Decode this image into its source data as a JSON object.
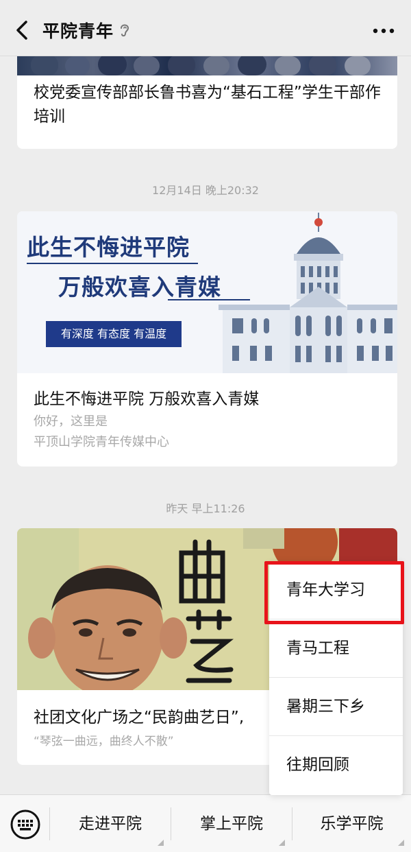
{
  "nav": {
    "title": "平院青年",
    "back_icon": "chevron-left-icon",
    "ear_icon": "ear-icon",
    "more_icon": "more-dots-icon"
  },
  "articles": [
    {
      "title": "校党委宣传部部长鲁书喜为“基石工程”学生干部作培训"
    },
    {
      "time": "12月14日 晚上20:32",
      "banner_line1": "此生不悔进平院",
      "banner_line2": "万般欢喜入青媒",
      "banner_tag": "有深度  有态度  有温度",
      "title": "此生不悔进平院 万般欢喜入青媒",
      "desc_line1": "你好，这里是",
      "desc_line2": "平顶山学院青年传媒中心"
    },
    {
      "time": "昨天 早上11:26",
      "title": "社团文化广场之“民韵曲艺日”,",
      "desc": "“琴弦一曲远，曲终人不散”"
    }
  ],
  "popup_menu": {
    "items": [
      "青年大学习",
      "青马工程",
      "暑期三下乡",
      "往期回顾"
    ],
    "highlight_color": "#e8131a"
  },
  "bottom_menu": {
    "keyboard_icon": "keyboard-icon",
    "items": [
      "走进平院",
      "掌上平院",
      "乐学平院"
    ]
  }
}
